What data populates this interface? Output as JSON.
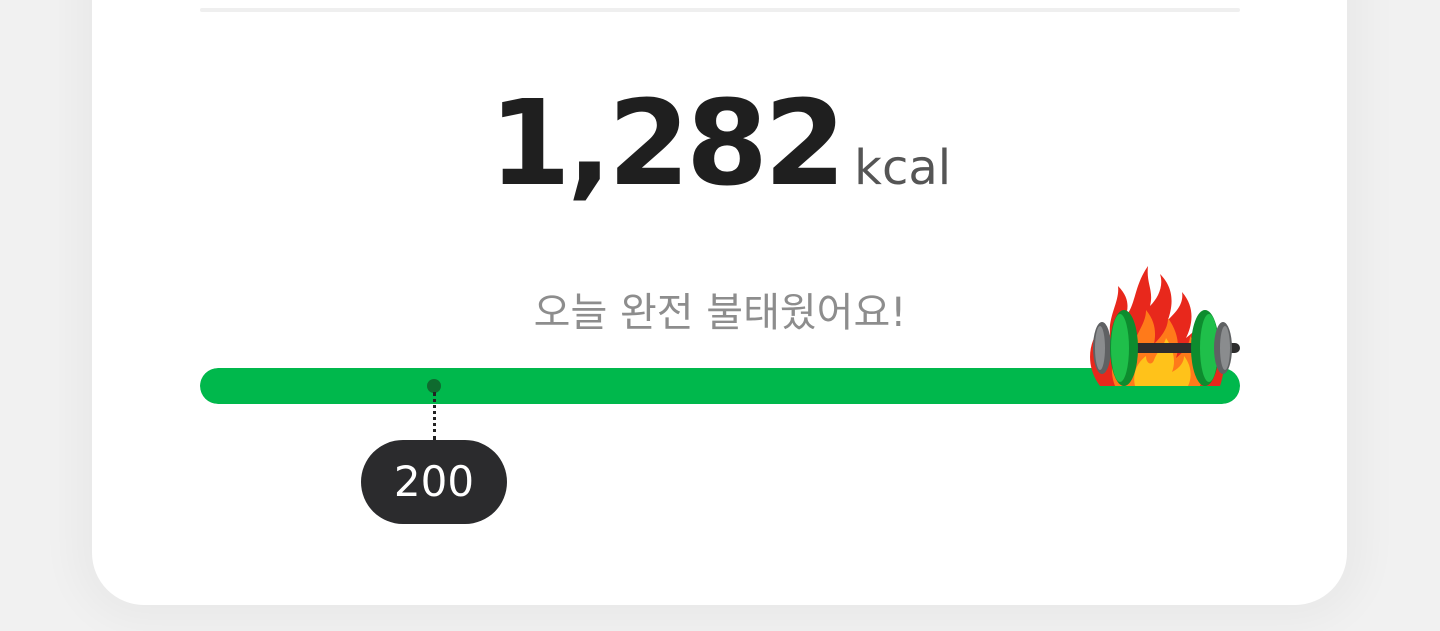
{
  "calories": {
    "value": "1,282",
    "unit": "kcal"
  },
  "message": "오늘 완전 불태웠어요!",
  "progress": {
    "fraction": 1.0,
    "marker_value": 200,
    "marker_label": "200",
    "marker_fraction": 0.225,
    "fill_color": "#00b84c",
    "track_color": "#e6e6e6"
  },
  "icons": {
    "goal_icon": "flaming-dumbbell-icon"
  }
}
